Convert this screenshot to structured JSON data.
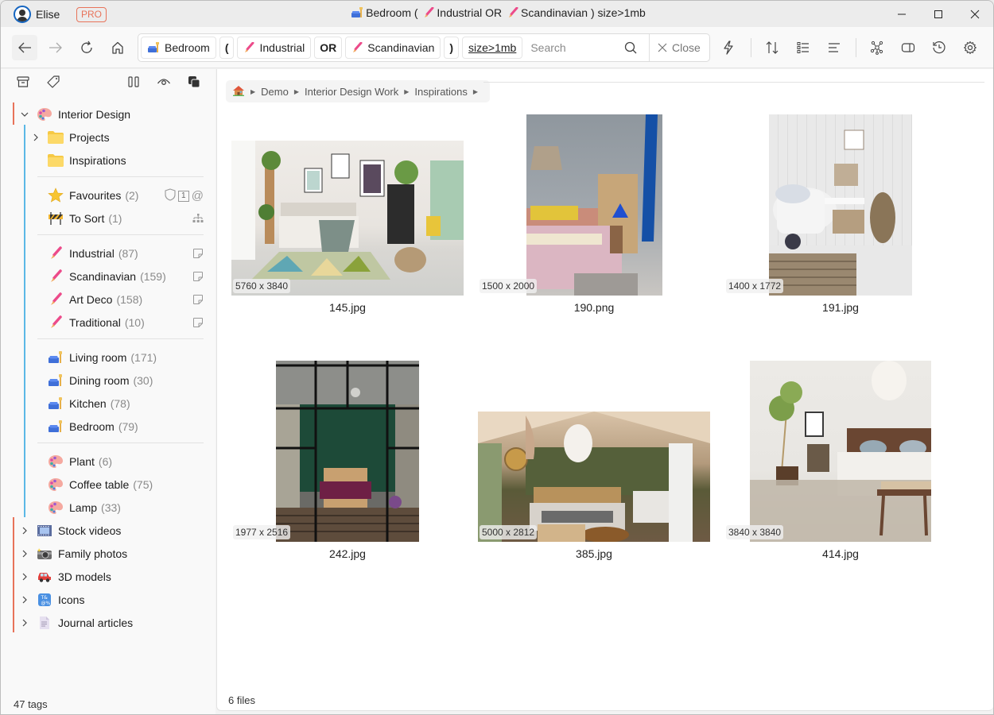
{
  "titlebar": {
    "username": "Elise",
    "badge": "PRO",
    "title_parts": [
      "Bedroom (",
      "Industrial OR",
      "Scandinavian ) size>1mb"
    ]
  },
  "toolbar": {
    "query_chips": [
      {
        "label": "Bedroom",
        "icon": "sofa-lamp-icon"
      },
      {
        "label": "(",
        "kind": "operator"
      },
      {
        "label": "Industrial",
        "icon": "paintbrush-icon"
      },
      {
        "label": "OR",
        "kind": "operator"
      },
      {
        "label": "Scandinavian",
        "icon": "paintbrush-icon"
      },
      {
        "label": ")",
        "kind": "operator"
      },
      {
        "label": "size>1mb",
        "kind": "filter"
      }
    ],
    "search_placeholder": "Search",
    "close_label": "Close"
  },
  "sidebar": {
    "root": {
      "label": "Interior Design",
      "icon": "palette-icon",
      "expanded": true
    },
    "folders": [
      {
        "label": "Projects",
        "has_children": true
      },
      {
        "label": "Inspirations",
        "has_children": false
      }
    ],
    "smart": [
      {
        "label": "Favourites",
        "count": "(2)",
        "icon": "star-icon"
      },
      {
        "label": "To Sort",
        "count": "(1)",
        "icon": "barrier-icon"
      }
    ],
    "favourites_badge": "1",
    "styles": [
      {
        "label": "Industrial",
        "count": "(87)"
      },
      {
        "label": "Scandinavian",
        "count": "(159)"
      },
      {
        "label": "Art Deco",
        "count": "(158)"
      },
      {
        "label": "Traditional",
        "count": "(10)"
      }
    ],
    "rooms": [
      {
        "label": "Living room",
        "count": "(171)"
      },
      {
        "label": "Dining room",
        "count": "(30)"
      },
      {
        "label": "Kitchen",
        "count": "(78)"
      },
      {
        "label": "Bedroom",
        "count": "(79)"
      }
    ],
    "objects": [
      {
        "label": "Plant",
        "count": "(6)"
      },
      {
        "label": "Coffee table",
        "count": "(75)"
      },
      {
        "label": "Lamp",
        "count": "(33)"
      }
    ],
    "libraries": [
      {
        "label": "Stock videos",
        "icon": "film-icon"
      },
      {
        "label": "Family photos",
        "icon": "camera-icon"
      },
      {
        "label": "3D models",
        "icon": "car-icon"
      },
      {
        "label": "Icons",
        "icon": "symbols-icon"
      },
      {
        "label": "Journal articles",
        "icon": "document-icon"
      }
    ],
    "footer": "47 tags"
  },
  "main": {
    "breadcrumb": [
      "Demo",
      "Interior Design Work",
      "Inspirations"
    ],
    "files": [
      {
        "name": "145.jpg",
        "dims": "5760 x 3840"
      },
      {
        "name": "190.png",
        "dims": "1500 x 2000"
      },
      {
        "name": "191.jpg",
        "dims": "1400 x 1772"
      },
      {
        "name": "242.jpg",
        "dims": "1977 x 2516"
      },
      {
        "name": "385.jpg",
        "dims": "5000 x 2812"
      },
      {
        "name": "414.jpg",
        "dims": "3840 x 3840"
      }
    ],
    "status": "6 files"
  },
  "colors": {
    "pro": "#e8735a",
    "root_accent": "#e8735a",
    "tree_accent": "#5bb8e6",
    "brush": "#ec4b8a"
  }
}
